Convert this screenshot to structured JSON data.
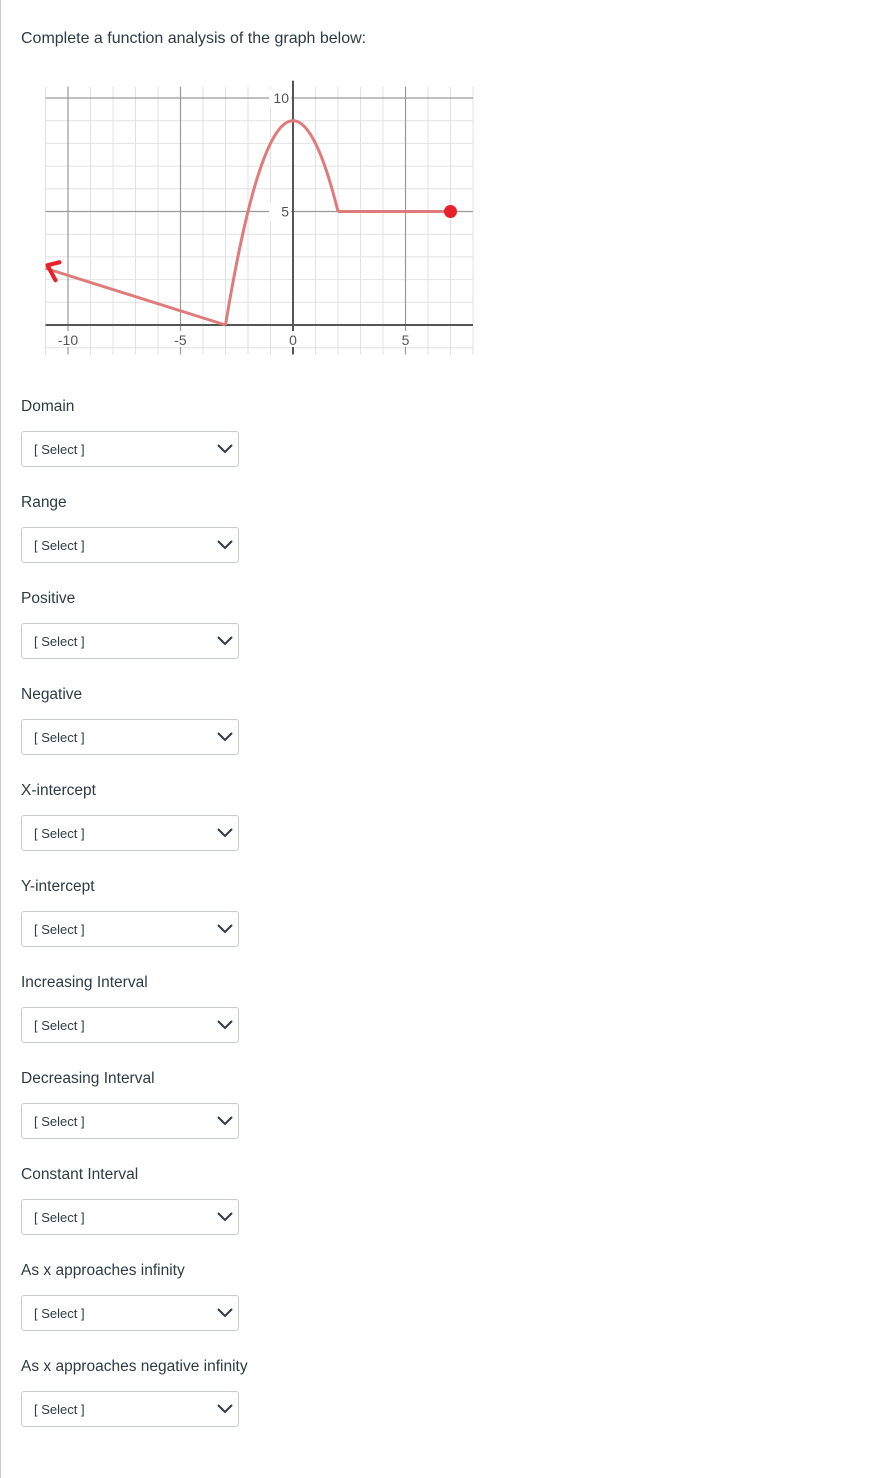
{
  "question": {
    "text": "Complete a function analysis of the graph below:"
  },
  "fields": [
    {
      "label": "Domain",
      "value": "[ Select ]"
    },
    {
      "label": "Range",
      "value": "[ Select ]"
    },
    {
      "label": "Positive",
      "value": "[ Select ]"
    },
    {
      "label": "Negative",
      "value": "[ Select ]"
    },
    {
      "label": "X-intercept",
      "value": "[ Select ]"
    },
    {
      "label": "Y-intercept",
      "value": "[ Select ]"
    },
    {
      "label": "Increasing Interval",
      "value": "[ Select ]"
    },
    {
      "label": "Decreasing Interval",
      "value": "[ Select ]"
    },
    {
      "label": "Constant Interval",
      "value": "[ Select ]"
    },
    {
      "label": "As x approaches infinity",
      "value": "[ Select ]"
    },
    {
      "label": "As x approaches negative infinity",
      "value": "[ Select ]"
    }
  ],
  "chart_data": {
    "type": "line",
    "title": "",
    "xlabel": "",
    "ylabel": "",
    "xlim": [
      -11,
      8
    ],
    "ylim": [
      -1.3,
      10.5
    ],
    "grid": true,
    "x_ticks": [
      -10,
      -5,
      0,
      5
    ],
    "x_tick_labels": [
      "-10",
      "-5",
      "0",
      "5"
    ],
    "y_ticks": [
      5,
      10
    ],
    "y_tick_labels": [
      "5",
      "10"
    ],
    "curve_color": "#e07b7b",
    "marker_color": "#e8202a",
    "segments": [
      {
        "kind": "linear",
        "points": [
          [
            -11,
            2.5
          ],
          [
            -3,
            0
          ]
        ],
        "left_end": "arrow"
      },
      {
        "kind": "parabola",
        "from_x": -3,
        "to_x": 2,
        "vertex": [
          0,
          9
        ],
        "points": [
          [
            -3,
            0
          ],
          [
            0,
            9
          ],
          [
            2,
            5
          ]
        ]
      },
      {
        "kind": "constant",
        "points": [
          [
            2,
            5
          ],
          [
            7,
            5
          ]
        ],
        "right_end": "closed-dot"
      }
    ]
  }
}
